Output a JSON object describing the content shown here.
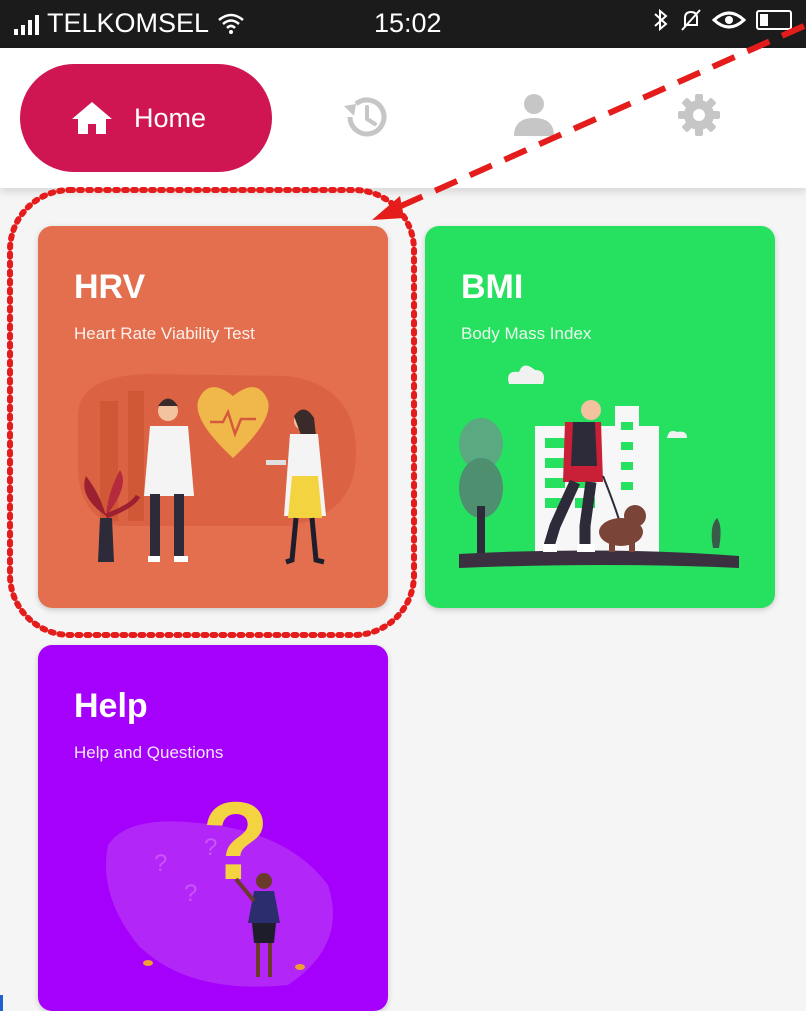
{
  "status_bar": {
    "carrier": "TELKOMSEL",
    "time": "15:02"
  },
  "nav": {
    "home_label": "Home",
    "icons": [
      "home-icon",
      "history-icon",
      "profile-icon",
      "settings-icon"
    ]
  },
  "cards": [
    {
      "title": "HRV",
      "subtitle": "Heart Rate Viability Test",
      "color": "#e36f4e"
    },
    {
      "title": "BMI",
      "subtitle": "Body Mass Index",
      "color": "#26e060"
    },
    {
      "title": "Help",
      "subtitle": "Help and Questions",
      "color": "#a500fb"
    }
  ],
  "colors": {
    "home_active": "#cf1552",
    "annotation": "#e51c1c"
  }
}
